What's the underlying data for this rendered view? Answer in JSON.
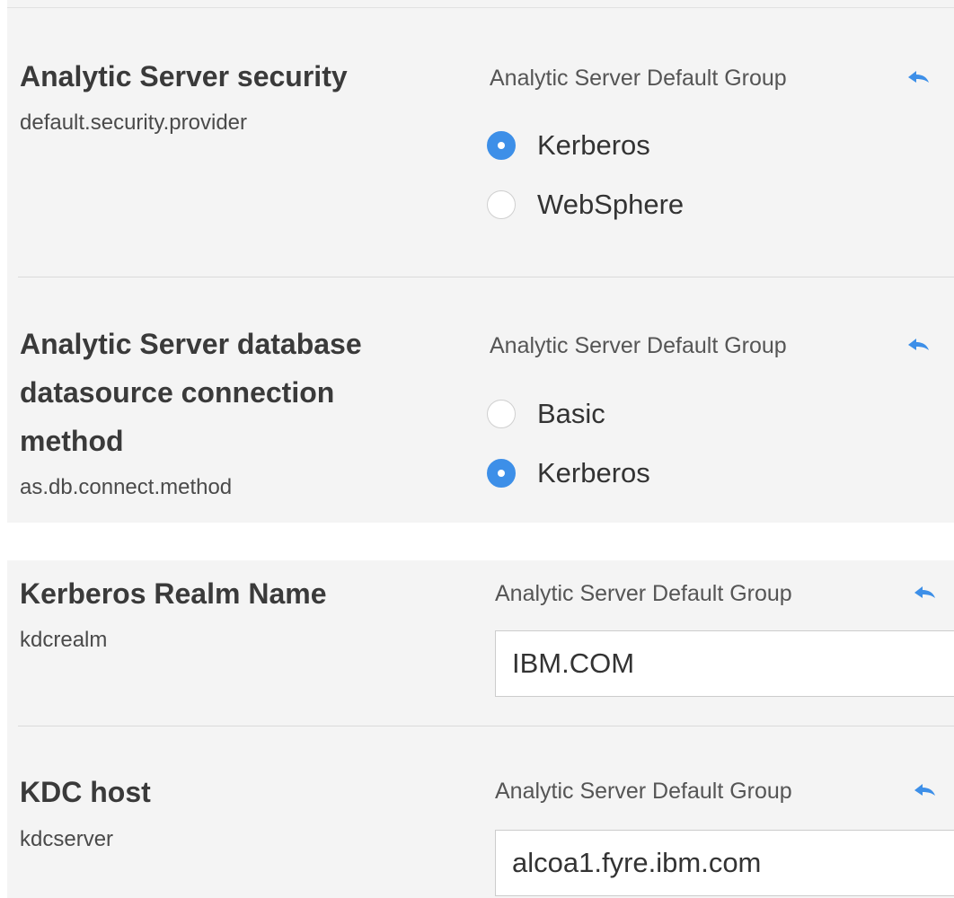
{
  "settings": [
    {
      "title_lines": [
        "Analytic Server security"
      ],
      "key": "default.security.provider",
      "group": "Analytic Server Default Group",
      "options": [
        {
          "label": "Kerberos",
          "selected": true
        },
        {
          "label": "WebSphere",
          "selected": false
        }
      ]
    },
    {
      "title_lines": [
        "Analytic Server database",
        "datasource connection",
        "method"
      ],
      "key": "as.db.connect.method",
      "group": "Analytic Server Default Group",
      "options": [
        {
          "label": "Basic",
          "selected": false
        },
        {
          "label": "Kerberos",
          "selected": true
        }
      ]
    },
    {
      "title_lines": [
        "Kerberos Realm Name"
      ],
      "key": "kdcrealm",
      "group": "Analytic Server Default Group",
      "input_value": "IBM.COM"
    },
    {
      "title_lines": [
        "KDC host"
      ],
      "key": "kdcserver",
      "group": "Analytic Server Default Group",
      "input_value": "alcoa1.fyre.ibm.com"
    }
  ],
  "icons": {
    "revert": "undo-arrow-icon"
  },
  "colors": {
    "accent": "#3d8fe8",
    "panel_background": "#f4f4f4",
    "divider": "#dadada"
  }
}
